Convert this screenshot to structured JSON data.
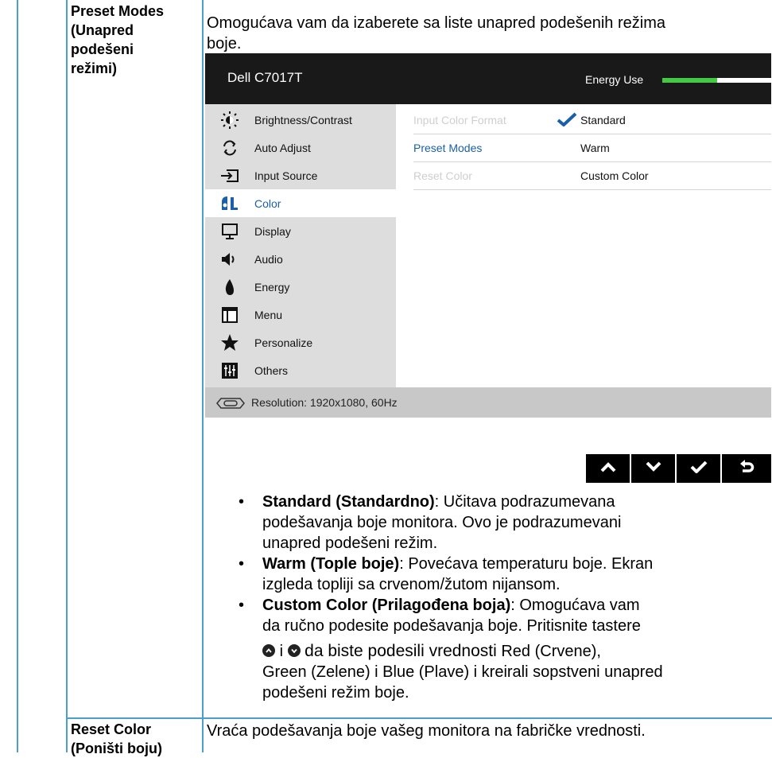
{
  "rows": {
    "preset_label_lines": [
      "Preset Modes",
      "(Unapred",
      "podešeni",
      "režimi)"
    ],
    "preset_desc_lines": [
      "Omogućava vam da izaberete sa liste unapred podešenih režima",
      "boje."
    ],
    "reset_label_lines": [
      "Reset Color",
      "(Poništi boju)"
    ],
    "reset_desc": "Vraća podešavanja boje vašeg monitora na fabričke vrednosti."
  },
  "osd": {
    "title": "Dell C7017T",
    "energy_label": "Energy Use",
    "energy_level": 0.5,
    "menu": [
      {
        "label": "Brightness/Contrast",
        "icon": "brightness-icon"
      },
      {
        "label": "Auto Adjust",
        "icon": "auto-adjust-icon"
      },
      {
        "label": "Input Source",
        "icon": "input-source-icon"
      },
      {
        "label": "Color",
        "icon": "color-icon",
        "active": true
      },
      {
        "label": "Display",
        "icon": "display-icon"
      },
      {
        "label": "Audio",
        "icon": "audio-icon"
      },
      {
        "label": "Energy",
        "icon": "energy-icon"
      },
      {
        "label": "Menu",
        "icon": "menu-icon"
      },
      {
        "label": "Personalize",
        "icon": "star-icon"
      },
      {
        "label": "Others",
        "icon": "others-icon"
      }
    ],
    "submenu": [
      {
        "label": "Input Color Format",
        "value": "Standard",
        "checked": true,
        "state": "disabled"
      },
      {
        "label": "Preset Modes",
        "value": "Warm",
        "state": "selected"
      },
      {
        "label": "Reset Color",
        "value": "Custom Color",
        "state": "disabled"
      }
    ],
    "footer": "Resolution: 1920x1080, 60Hz",
    "colors": {
      "header_bg": "#191919",
      "energy_green": "#45c945",
      "selected_blue": "#1a5fa8",
      "disabled_gray": "#cfcfcf",
      "menu_bg": "#dddddd"
    }
  },
  "nav_buttons": [
    "up-icon",
    "down-icon",
    "check-icon",
    "back-icon"
  ],
  "bullets": [
    {
      "title": "Standard (Standardno)",
      "lines": [
        "Učitava podrazumevana",
        "podešavanja boje monitora. Ovo je podrazumevani",
        "unapred podešeni režim."
      ]
    },
    {
      "title": "Warm (Tople boje)",
      "lines": [
        "Povećava temperaturu boje. Ekran",
        "izgleda topliji sa crvenom/žutom nijansom."
      ]
    },
    {
      "title": "Custom Color (Prilagođena boja)",
      "lines": [
        "Omogućava vam",
        "da ručno podesite podešavanja boje. Pritisnite tastere",
        "i",
        "da biste podesili vrednosti",
        "Red (Crvene),",
        "Green (Zelene) i Blue (Plave) i kreirali sopstveni unapred",
        "podešeni režim boje."
      ]
    }
  ],
  "bullet_mark": "•"
}
